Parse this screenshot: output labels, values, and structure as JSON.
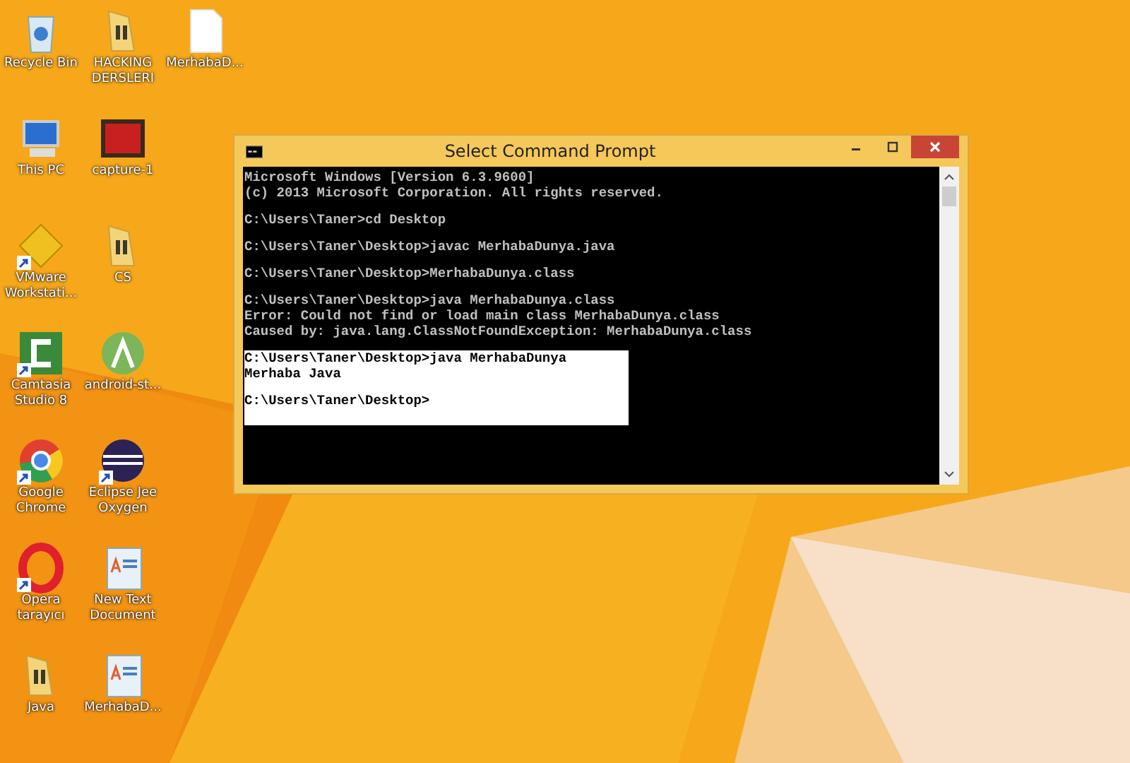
{
  "desktop_icons": [
    {
      "label": "Recycle Bin",
      "kind": "recycle",
      "shortcut": false
    },
    {
      "label": "This PC",
      "kind": "pc",
      "shortcut": false
    },
    {
      "label": "VMware Workstati...",
      "kind": "vmware",
      "shortcut": true
    },
    {
      "label": "Camtasia Studio 8",
      "kind": "camtasia",
      "shortcut": true
    },
    {
      "label": "Google Chrome",
      "kind": "chrome",
      "shortcut": true
    },
    {
      "label": "Opera tarayıcı",
      "kind": "opera",
      "shortcut": true
    },
    {
      "label": "Java",
      "kind": "folder",
      "shortcut": false
    },
    {
      "label": "HACKING DERSLERI",
      "kind": "folder",
      "shortcut": false
    },
    {
      "label": "capture-1",
      "kind": "video",
      "shortcut": false
    },
    {
      "label": "CS",
      "kind": "folder",
      "shortcut": false
    },
    {
      "label": "android-st...",
      "kind": "android",
      "shortcut": false
    },
    {
      "label": "Eclipse Jee Oxygen",
      "kind": "eclipse",
      "shortcut": true
    },
    {
      "label": "New Text Document",
      "kind": "textdoc",
      "shortcut": false
    },
    {
      "label": "MerhabaD...",
      "kind": "textdoc",
      "shortcut": false
    },
    {
      "label": "MerhabaD...",
      "kind": "file",
      "shortcut": false
    }
  ],
  "window": {
    "title": "Select Command Prompt",
    "console_blocks": [
      {
        "selected": false,
        "lines": [
          "Microsoft Windows [Version 6.3.9600]",
          "(c) 2013 Microsoft Corporation. All rights reserved."
        ]
      },
      {
        "selected": false,
        "lines": [
          "C:\\Users\\Taner>cd Desktop"
        ]
      },
      {
        "selected": false,
        "lines": [
          "C:\\Users\\Taner\\Desktop>javac MerhabaDunya.java"
        ]
      },
      {
        "selected": false,
        "lines": [
          "C:\\Users\\Taner\\Desktop>MerhabaDunya.class"
        ]
      },
      {
        "selected": false,
        "lines": [
          "C:\\Users\\Taner\\Desktop>java MerhabaDunya.class",
          "Error: Could not find or load main class MerhabaDunya.class",
          "Caused by: java.lang.ClassNotFoundException: MerhabaDunya.class"
        ]
      },
      {
        "selected": true,
        "lines": [
          "C:\\Users\\Taner\\Desktop>java MerhabaDunya",
          "Merhaba Java"
        ]
      },
      {
        "selected": true,
        "lines": [
          "C:\\Users\\Taner\\Desktop>"
        ]
      }
    ]
  }
}
